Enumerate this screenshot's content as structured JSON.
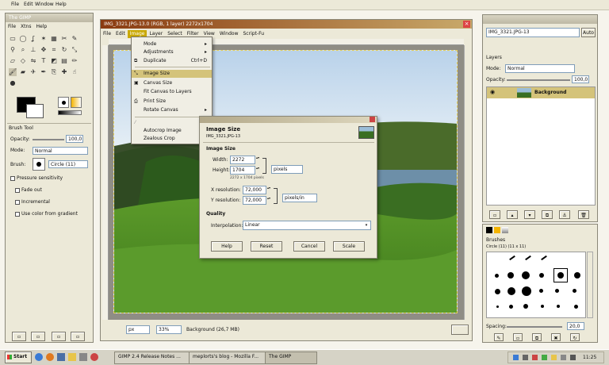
{
  "top_menubar": [
    "File",
    "Edit",
    "Window",
    "Help"
  ],
  "toolbox": {
    "title": "The GIMP",
    "menu": [
      "File",
      "Xtns",
      "Help"
    ],
    "tool_options": {
      "title": "Brush Tool",
      "opacity_label": "Opacity:",
      "opacity_value": "100,0",
      "mode_label": "Mode:",
      "mode_value": "Normal",
      "brush_label": "Brush:",
      "brush_name": "Circle (11)",
      "pressure": "Pressure sensitivity",
      "fade_out": "Fade out",
      "incremental": "Incremental",
      "use_color": "Use color from gradient"
    }
  },
  "image_window": {
    "title": "IMG_3321.JPG-13.0 (RGB, 1 layer) 2272x1704",
    "menu": [
      "File",
      "Edit",
      "Image",
      "Layer",
      "Select",
      "Filter",
      "View",
      "Window",
      "Script-Fu"
    ],
    "status_unit": "px",
    "status_zoom": "33%",
    "status_text": "Background (26,7 MB)"
  },
  "image_menu": {
    "items": [
      {
        "label": "Mode",
        "submenu": true
      },
      {
        "label": "Adjustments",
        "submenu": true
      },
      {
        "label": "Duplicate",
        "shortcut": "Ctrl+D"
      },
      {
        "label": "Image Size",
        "highlight": true
      },
      {
        "label": "Canvas Size"
      },
      {
        "label": "Fit Canvas to Layers"
      },
      {
        "label": "Print Size"
      },
      {
        "label": "Rotate Canvas",
        "submenu": true
      },
      {
        "label": "Autocrop Image"
      },
      {
        "label": "Zealous Crop"
      }
    ]
  },
  "dialog": {
    "heading": "Image Size",
    "subheading": "IMG_3321.JPG-13",
    "section_size": "Image Size",
    "width_label": "Width:",
    "width_value": "2272",
    "height_label": "Height:",
    "height_value": "1704",
    "unit": "pixels",
    "dims_text": "2272 x 1704 pixels",
    "xres_label": "X resolution:",
    "xres_value": "72,000",
    "yres_label": "Y resolution:",
    "yres_value": "72,000",
    "res_unit": "pixels/in",
    "section_quality": "Quality",
    "interp_label": "Interpolation:",
    "interp_value": "Linear",
    "buttons": [
      "Help",
      "Reset",
      "Cancel",
      "Scale"
    ]
  },
  "layers_dock": {
    "image_select": "IMG_3321.JPG-13",
    "auto_label": "Auto",
    "tab_title": "Layers",
    "mode_label": "Mode:",
    "mode_value": "Normal",
    "opacity_label": "Opacity:",
    "opacity_value": "100,0",
    "layer_name": "Background"
  },
  "brushes_dock": {
    "title": "Brushes",
    "brush_info": "Circle (11) (11 x 11)",
    "spacing_label": "Spacing:",
    "spacing_value": "20,0"
  },
  "taskbar": {
    "start": "Start",
    "items": [
      "GIMP 2.4 Release Notes ...",
      "meplorts's blog - Mozilla F...",
      "The GIMP"
    ],
    "clock": "11:25"
  },
  "colors": {
    "image_menu_active": "#c9a800",
    "titlebar": "#8a3a10",
    "selection": "#d4c37a"
  }
}
